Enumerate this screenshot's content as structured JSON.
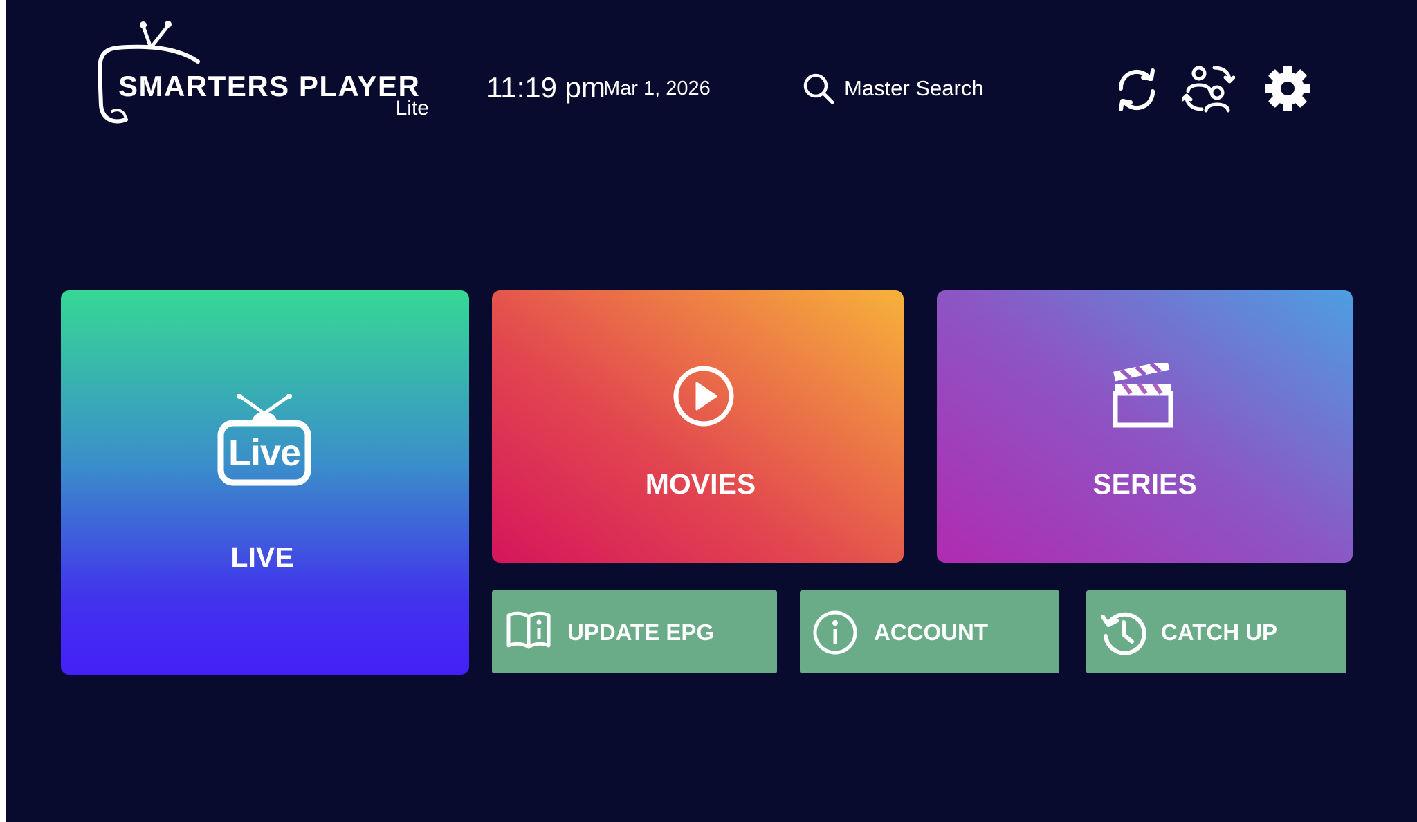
{
  "app": {
    "logo_title": "SMARTERS PLAYER",
    "logo_subtitle": "Lite"
  },
  "header": {
    "time": "11:19 pm",
    "date": "Mar 1, 2026",
    "search_label": "Master Search",
    "icons": [
      "refresh-icon",
      "switch-user-icon",
      "settings-gear-icon"
    ]
  },
  "tiles": {
    "live": {
      "label": "LIVE",
      "badge": "Live",
      "icon": "live-tv-icon"
    },
    "movies": {
      "label": "MOVIES",
      "icon": "play-circle-icon"
    },
    "series": {
      "label": "SERIES",
      "icon": "clapperboard-icon"
    }
  },
  "buttons": {
    "update_epg": {
      "label": "UPDATE EPG",
      "icon": "book-info-icon"
    },
    "account": {
      "label": "ACCOUNT",
      "icon": "info-circle-icon"
    },
    "catch_up": {
      "label": "CATCH UP",
      "icon": "history-clock-icon"
    }
  },
  "colors": {
    "background": "#080b2d",
    "button_green": "#6aac88",
    "text": "#ffffff"
  }
}
